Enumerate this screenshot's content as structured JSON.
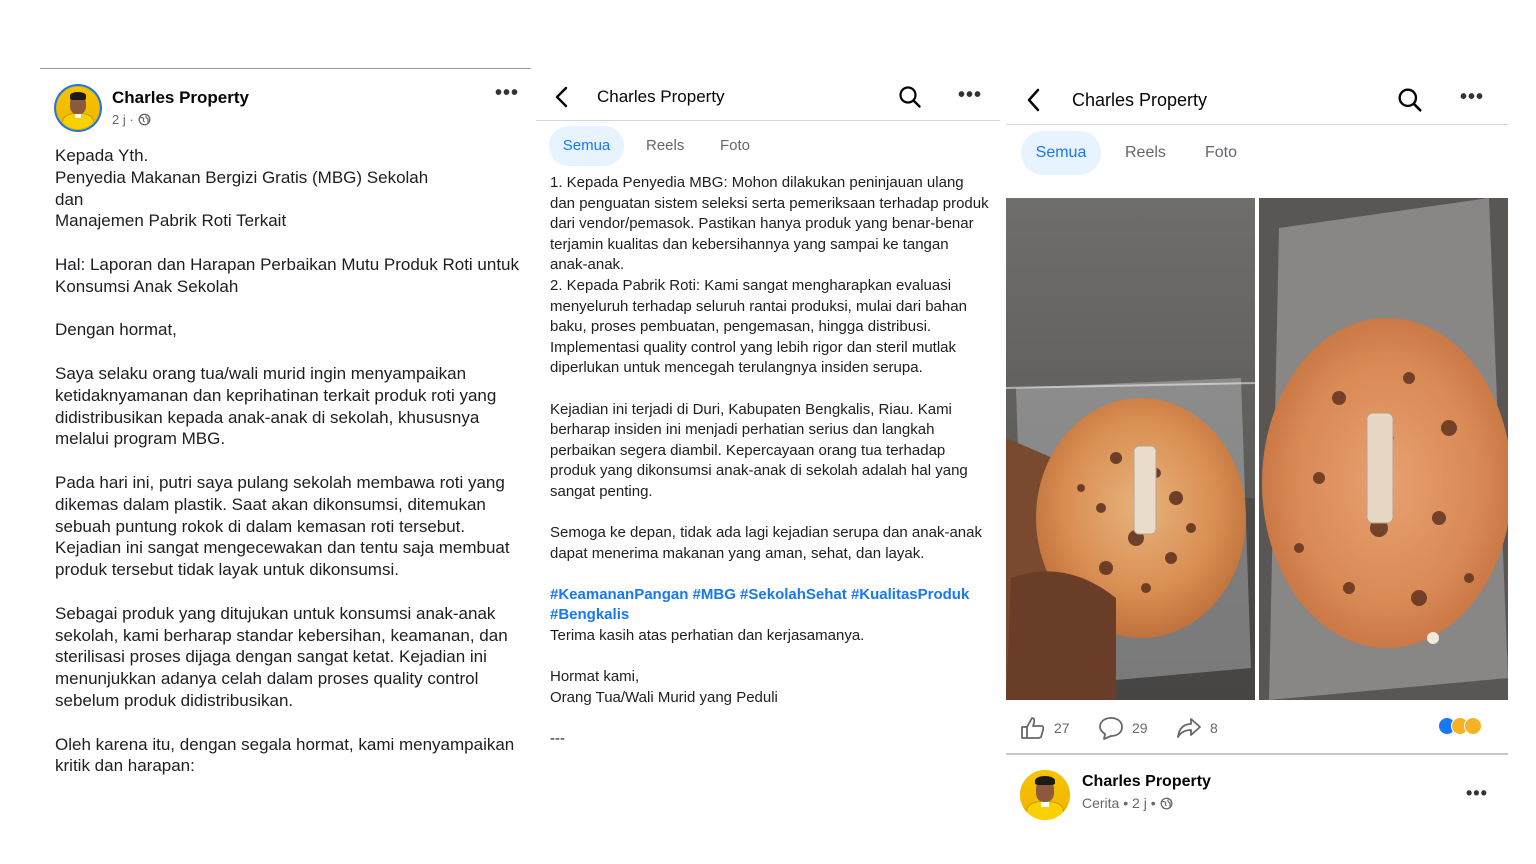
{
  "post_left": {
    "author": "Charles Property",
    "time": "2 j ·",
    "paragraphs": [
      "Kepada Yth.\nPenyedia Makanan Bergizi Gratis (MBG) Sekolah\ndan\nManajemen Pabrik Roti Terkait",
      "Hal: Laporan dan Harapan Perbaikan Mutu Produk Roti untuk Konsumsi Anak Sekolah",
      "Dengan hormat,",
      "Saya selaku orang tua/wali murid ingin menyampaikan ketidaknyamanan dan keprihatinan terkait produk roti yang didistribusikan kepada anak-anak di sekolah, khususnya melalui program MBG.",
      "Pada hari ini, putri saya pulang sekolah membawa roti yang dikemas dalam plastik. Saat akan dikonsumsi, ditemukan sebuah puntung rokok di dalam kemasan roti tersebut. Kejadian ini sangat mengecewakan dan tentu saja membuat produk tersebut tidak layak untuk dikonsumsi.",
      "Sebagai produk yang ditujukan untuk konsumsi anak-anak sekolah, kami berharap standar kebersihan, keamanan, dan sterilisasi proses dijaga dengan sangat ketat. Kejadian ini menunjukkan adanya celah dalam proses quality control sebelum produk didistribusikan.",
      "Oleh karena itu, dengan segala hormat, kami menyampaikan kritik dan harapan:"
    ]
  },
  "post_middle": {
    "header_title": "Charles Property",
    "tabs": [
      "Semua",
      "Reels",
      "Foto"
    ],
    "paragraphs": [
      "1. Kepada Penyedia MBG: Mohon dilakukan peninjauan ulang dan penguatan sistem seleksi serta pemeriksaan terhadap produk dari vendor/pemasok. Pastikan hanya produk yang benar-benar terjamin kualitas dan kebersihannya yang sampai ke tangan anak-anak.\n2. Kepada Pabrik Roti: Kami sangat mengharapkan evaluasi menyeluruh terhadap seluruh rantai produksi, mulai dari bahan baku, proses pembuatan, pengemasan, hingga distribusi. Implementasi quality control yang lebih rigor dan steril mutlak diperlukan untuk mencegah terulangnya insiden serupa.",
      "Kejadian ini terjadi di Duri, Kabupaten Bengkalis, Riau. Kami berharap insiden ini menjadi perhatian serius dan langkah perbaikan segera diambil. Kepercayaan orang tua terhadap produk yang dikonsumsi anak-anak di sekolah adalah hal yang sangat penting.",
      "Semoga ke depan, tidak ada lagi kejadian serupa dan anak-anak dapat menerima makanan yang aman, sehat, dan layak."
    ],
    "hashtags": "#KeamananPangan #MBG #SekolahSehat #KualitasProduk #Bengkalis",
    "thanks": "Terima kasih atas perhatian dan kerjasamanya.",
    "closing": "Hormat kami,\nOrang Tua/Wali Murid yang Peduli",
    "separator": "---"
  },
  "post_right": {
    "header_title": "Charles Property",
    "tabs": [
      "Semua",
      "Reels",
      "Foto"
    ],
    "likes": "27",
    "comments": "29",
    "shares": "8",
    "story_author": "Charles Property",
    "story_meta": "Cerita • 2 j •",
    "reaction_colors": [
      "#1877f2",
      "#f7b125",
      "#f7b125"
    ]
  }
}
